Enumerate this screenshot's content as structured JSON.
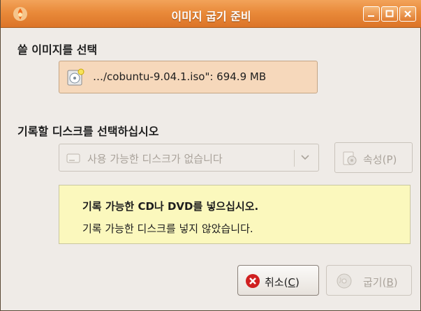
{
  "window": {
    "title": "이미지 굽기 준비"
  },
  "source": {
    "label": "쓸 이미지를 선택",
    "file_text": "…/cobuntu-9.04.1.iso\": 694.9 MB"
  },
  "target": {
    "label": "기록할 디스크를 선택하십시오",
    "combo_value": "사용 가능한 디스크가 없습니다",
    "properties_label": "속성(P)"
  },
  "info": {
    "title_prefix": "기록 가능한 ",
    "title_cd": "CD",
    "title_mid": "나 ",
    "title_dvd": "DVD",
    "title_suffix": "를 넣으십시오.",
    "message": "기록 가능한 디스크를 넣지 않았습니다."
  },
  "buttons": {
    "cancel_text": "취소(",
    "cancel_key": "C",
    "burn_text": "굽기(",
    "burn_key": "B",
    "close_paren": ")"
  },
  "colors": {
    "titlebar": "#e98a3a",
    "dialog_bg": "#efebe7",
    "info_bg": "#fbf8bd",
    "file_box_bg": "#f6d8bb",
    "cancel_icon": "#d02020"
  }
}
